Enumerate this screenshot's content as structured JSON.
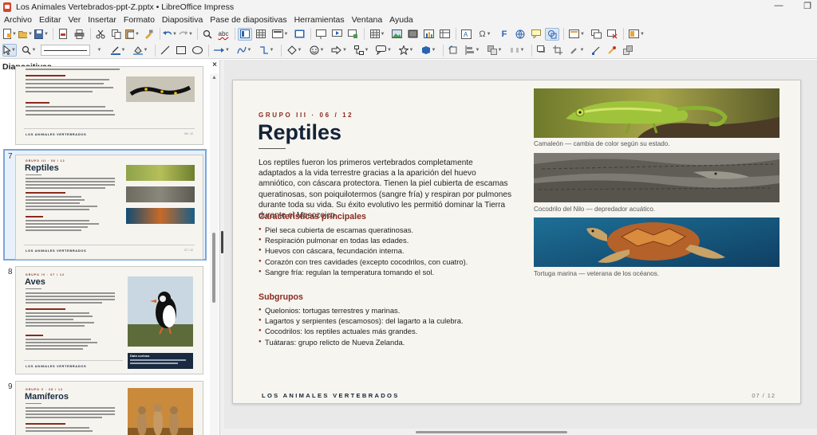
{
  "window": {
    "title": "Los Animales Vertebrados-ppt-Z.pptx • LibreOffice Impress",
    "min_label": "—",
    "restore_label": "❐"
  },
  "menu": [
    "Archivo",
    "Editar",
    "Ver",
    "Insertar",
    "Formato",
    "Diapositiva",
    "Pase de diapositivas",
    "Herramientas",
    "Ventana",
    "Ayuda"
  ],
  "panel": {
    "title": "Diapositivas",
    "close": "×"
  },
  "thumbs": [
    {
      "num": "7",
      "kicker": "GRUPO III · 06 / 12",
      "title": "Reptiles",
      "footer": "LOS ANIMALES VERTEBRADOS",
      "page": "07 / 12"
    },
    {
      "num": "8",
      "kicker": "GRUPO IV · 07 / 12",
      "title": "Aves",
      "footer": "LOS ANIMALES VERTEBRADOS",
      "page": "08 / 12",
      "box_title": "Dato curioso"
    },
    {
      "num": "9",
      "kicker": "GRUPO V · 08 / 12",
      "title": "Mamíferos"
    }
  ],
  "prev_thumb": {
    "footer": "LOS ANIMALES VERTEBRADOS",
    "page": "06 / 12"
  },
  "slide": {
    "kicker": "GRUPO III · 06 / 12",
    "title": "Reptiles",
    "intro": "Los reptiles fueron los primeros vertebrados completamente adaptados a la vida terrestre gracias a la aparición del huevo amniótico, con cáscara protectora. Tienen la piel cubierta de escamas queratinosas, son poiquilotermos (sangre fría) y respiran por pulmones durante toda su vida. Su éxito evolutivo les permitió dominar la Tierra durante el Mesozoico.",
    "sec1": "Características principales",
    "features": [
      "Piel seca cubierta de escamas queratinosas.",
      "Respiración pulmonar en todas las edades.",
      "Huevos con cáscara, fecundación interna.",
      "Corazón con tres cavidades (excepto cocodrilos, con cuatro).",
      "Sangre fría: regulan la temperatura tomando el sol."
    ],
    "sec2": "Subgrupos",
    "subgroups": [
      "Quelonios: tortugas terrestres y marinas.",
      "Lagartos y serpientes (escamosos): del lagarto a la culebra.",
      "Cocodrilos: los reptiles actuales más grandes.",
      "Tuátaras: grupo relicto de Nueva Zelanda."
    ],
    "captions": [
      "Camaleón — cambia de color según su estado.",
      "Cocodrilo del Nilo — depredador acuático.",
      "Tortuga marina — veterana de los océanos."
    ],
    "footer": "LOS ANIMALES VERTEBRADOS",
    "page": "07 / 12"
  },
  "colors": {
    "accent": "#8b2a1e",
    "title": "#142338",
    "selection": "#7ba7d8"
  }
}
